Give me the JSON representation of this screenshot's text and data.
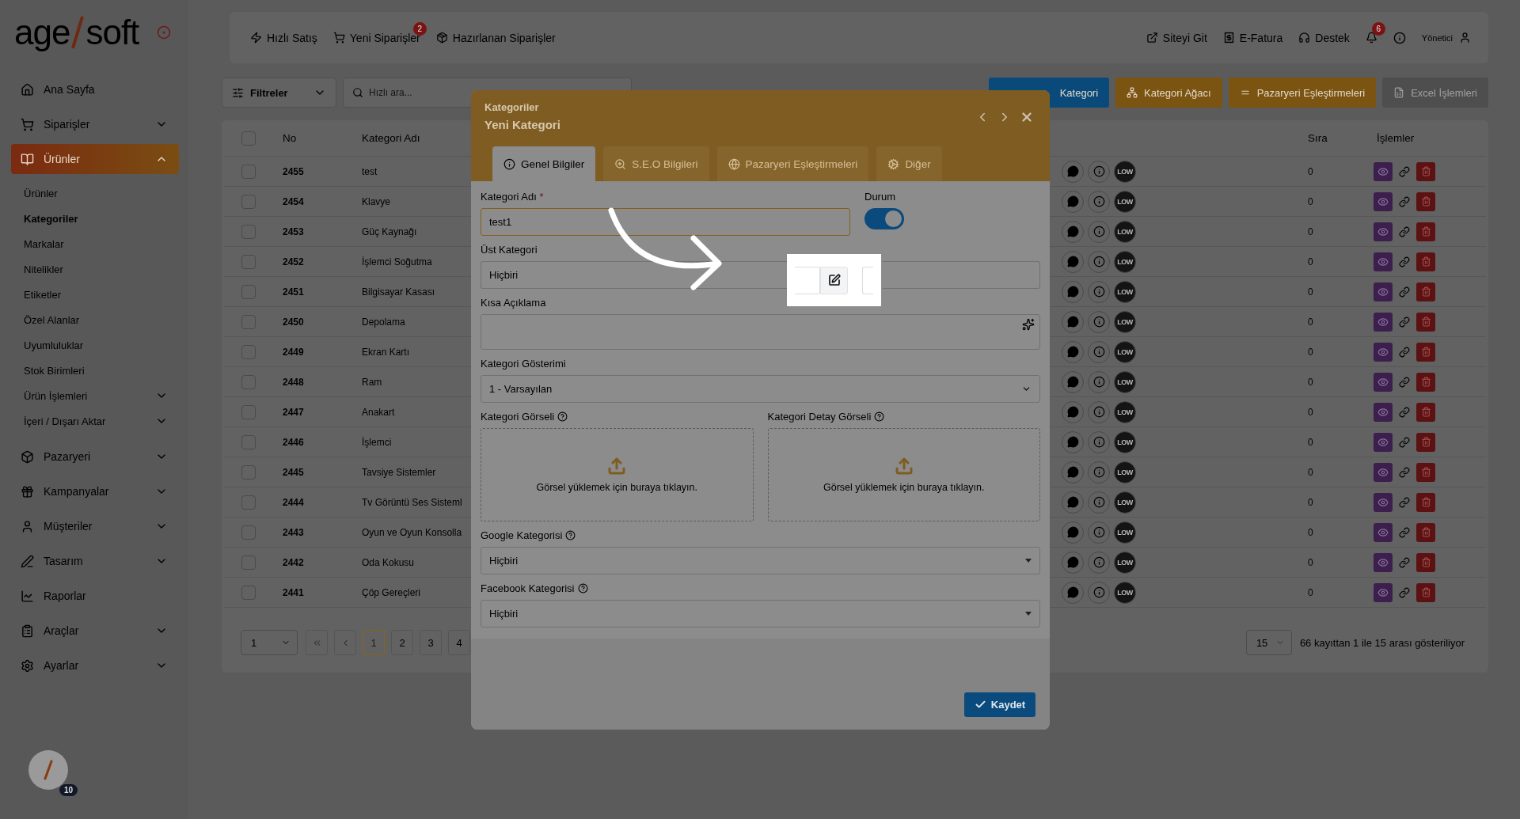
{
  "logo": {
    "left": "age",
    "right": "soft"
  },
  "topbar": {
    "quick_links": [
      {
        "label": "Hızlı Satış"
      },
      {
        "label": "Yeni Siparişler",
        "badge": "2"
      },
      {
        "label": "Hazırlanan Siparişler"
      }
    ],
    "right_links": [
      {
        "label": "Siteyi Git"
      },
      {
        "label": "E-Fatura"
      },
      {
        "label": "Destek"
      }
    ],
    "notifications": {
      "badge": "6"
    },
    "user": {
      "name": "Yönetici"
    }
  },
  "sidebar": {
    "items": [
      {
        "label": "Ana Sayfa",
        "kind": "link",
        "selected": false
      },
      {
        "label": "Siparişler",
        "kind": "group",
        "expanded": false,
        "selected": false
      },
      {
        "label": "Ürünler",
        "kind": "group",
        "expanded": true,
        "selected": true,
        "children": [
          {
            "label": "Ürünler",
            "kind": "link",
            "selected": false
          },
          {
            "label": "Kategoriler",
            "kind": "link",
            "selected": true
          },
          {
            "label": "Markalar",
            "kind": "link",
            "selected": false
          },
          {
            "label": "Nitelikler",
            "kind": "link",
            "selected": false
          },
          {
            "label": "Etiketler",
            "kind": "link",
            "selected": false
          },
          {
            "label": "Özel Alanlar",
            "kind": "link",
            "selected": false
          },
          {
            "label": "Uyumluluklar",
            "kind": "link",
            "selected": false
          },
          {
            "label": "Stok Birimleri",
            "kind": "link",
            "selected": false
          },
          {
            "label": "Ürün İşlemleri",
            "kind": "group",
            "expanded": false,
            "selected": false
          },
          {
            "label": "İçeri / Dışarı Aktar",
            "kind": "group",
            "expanded": false,
            "selected": false
          }
        ]
      },
      {
        "label": "Pazaryeri",
        "kind": "group",
        "expanded": false,
        "selected": false
      },
      {
        "label": "Kampanyalar",
        "kind": "group",
        "expanded": false,
        "selected": false
      },
      {
        "label": "Müşteriler",
        "kind": "group",
        "expanded": false,
        "selected": false
      },
      {
        "label": "Tasarım",
        "kind": "group",
        "expanded": false,
        "selected": false
      },
      {
        "label": "Raporlar",
        "kind": "link",
        "selected": false
      },
      {
        "label": "Araçlar",
        "kind": "group",
        "expanded": false,
        "selected": false
      },
      {
        "label": "Ayarlar",
        "kind": "group",
        "expanded": false,
        "selected": false
      }
    ],
    "help_badge": "10"
  },
  "toolbar": {
    "filter_button": "Filtreler",
    "search": {
      "placeholder": "Hızlı ara..."
    },
    "actions": [
      {
        "label": "Kategori",
        "color": "#0a4a7a",
        "disabled": false
      },
      {
        "label": "Kategori Ağacı",
        "color": "#7a5410",
        "disabled": false
      },
      {
        "label": "Pazaryeri Eşleştirmeleri",
        "color": "#7a5410",
        "disabled": false
      },
      {
        "label": "Excel İşlemleri",
        "color": "#4e4e4e",
        "disabled": true
      }
    ]
  },
  "table": {
    "select_all_checked": false,
    "columns": [
      "No",
      "Kategori Adı",
      "Sıra",
      "İşlemler"
    ],
    "rows": [
      {
        "no": "2455",
        "name": "test",
        "badge": "LOW",
        "order": "0",
        "checked": false
      },
      {
        "no": "2454",
        "name": "Klavye",
        "badge": "LOW",
        "order": "0",
        "checked": false
      },
      {
        "no": "2453",
        "name": "Güç Kaynağı",
        "badge": "LOW",
        "order": "0",
        "checked": false
      },
      {
        "no": "2452",
        "name": "İşlemci Soğutma",
        "badge": "LOW",
        "order": "0",
        "checked": false
      },
      {
        "no": "2451",
        "name": "Bilgisayar Kasası",
        "badge": "LOW",
        "order": "0",
        "checked": false
      },
      {
        "no": "2450",
        "name": "Depolama",
        "badge": "LOW",
        "order": "0",
        "checked": false
      },
      {
        "no": "2449",
        "name": "Ekran Kartı",
        "badge": "LOW",
        "order": "0",
        "checked": false
      },
      {
        "no": "2448",
        "name": "Ram",
        "badge": "LOW",
        "order": "0",
        "checked": false
      },
      {
        "no": "2447",
        "name": "Anakart",
        "badge": "LOW",
        "order": "0",
        "checked": false
      },
      {
        "no": "2446",
        "name": "İşlemci",
        "badge": "LOW",
        "order": "0",
        "checked": false
      },
      {
        "no": "2445",
        "name": "Tavsiye Sistemler",
        "badge": "LOW",
        "order": "0",
        "checked": false
      },
      {
        "no": "2444",
        "name": "Tv Görüntü Ses Sisteml",
        "badge": "LOW",
        "order": "0",
        "checked": false
      },
      {
        "no": "2443",
        "name": "Oyun ve Oyun Konsolla",
        "badge": "LOW",
        "order": "0",
        "checked": false
      },
      {
        "no": "2442",
        "name": "Oda Kokusu",
        "badge": "LOW",
        "order": "0",
        "checked": false
      },
      {
        "no": "2441",
        "name": "Çöp Gereçleri",
        "badge": "LOW",
        "order": "0",
        "checked": false
      }
    ],
    "pagination": {
      "page_select": "1",
      "pages": [
        {
          "label": "1",
          "selected": true
        },
        {
          "label": "2",
          "selected": false
        },
        {
          "label": "3",
          "selected": false
        },
        {
          "label": "4",
          "selected": false
        }
      ],
      "per_page": "15",
      "summary": "66 kayıttan 1 ile 15 arası gösteriliyor"
    }
  },
  "modal": {
    "breadcrumb": "Kategoriler",
    "title": "Yeni Kategori",
    "tabs": [
      {
        "label": "Genel Bilgiler",
        "selected": true
      },
      {
        "label": "S.E.O Bilgileri",
        "selected": false
      },
      {
        "label": "Pazaryeri Eşleştirmeleri",
        "selected": false
      },
      {
        "label": "Diğer",
        "selected": false
      }
    ],
    "name_field": {
      "label": "Kategori Adı",
      "required_mark": "*",
      "value": "test1"
    },
    "status": {
      "label": "Durum",
      "on": true
    },
    "parent_field": {
      "label": "Üst Kategori",
      "value": "Hiçbiri"
    },
    "description": {
      "label": "Kısa Açıklama"
    },
    "display_field": {
      "label": "Kategori Gösterimi",
      "value": "1 - Varsayılan"
    },
    "uploads": [
      {
        "label": "Kategori Görseli",
        "hint": "Görsel yüklemek için buraya tıklayın."
      },
      {
        "label": "Kategori Detay Görseli",
        "hint": "Görsel yüklemek için buraya tıklayın."
      }
    ],
    "google_field": {
      "label": "Google Kategorisi",
      "value": "Hiçbiri"
    },
    "facebook_field": {
      "label": "Facebook Kategorisi",
      "value": "Hiçbiri"
    },
    "save_button": "Kaydet"
  }
}
